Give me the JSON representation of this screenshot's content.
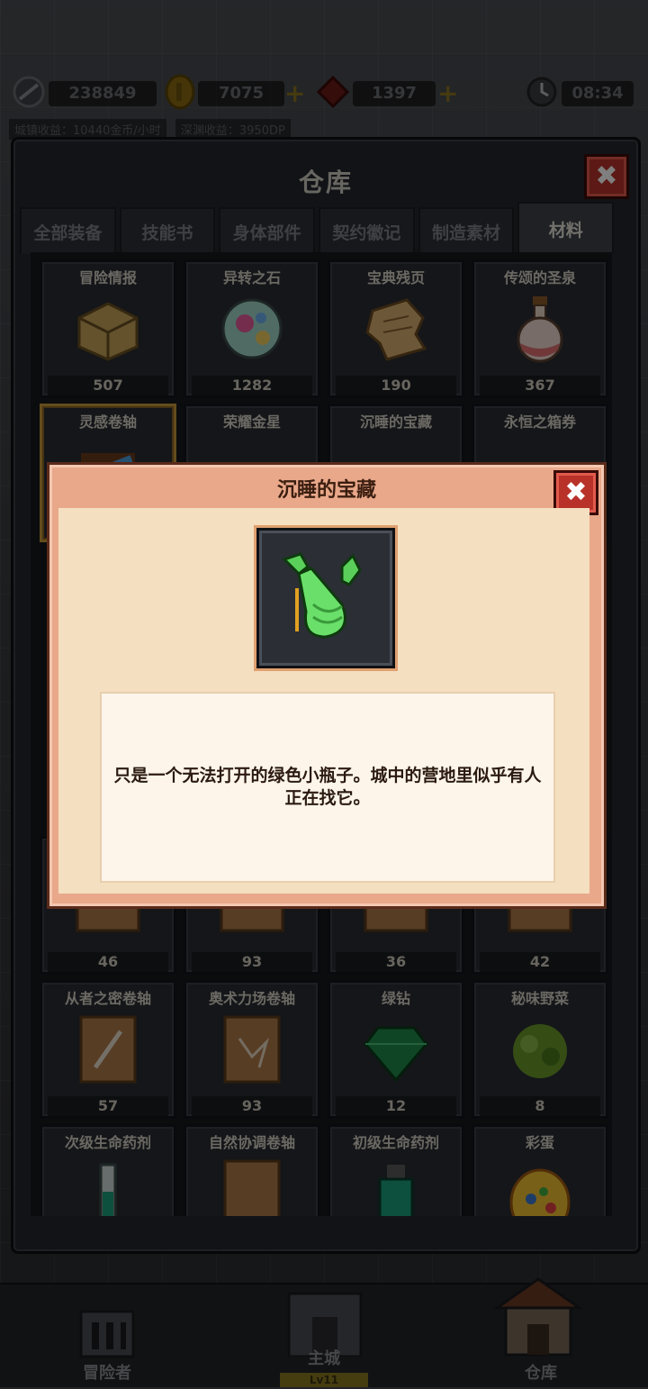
{
  "top": {
    "souls": "238849",
    "gold": "7075",
    "gems": "1397",
    "time": "08:34",
    "town_income": "城镇收益：10440金币/小时",
    "abyss_income": "深渊收益：3950DP"
  },
  "warehouse": {
    "title": "仓库",
    "close_symbol": "✖",
    "tabs": [
      {
        "label": "全部装备"
      },
      {
        "label": "技能书"
      },
      {
        "label": "身体部件"
      },
      {
        "label": "契约徽记"
      },
      {
        "label": "制造素材"
      },
      {
        "label": "材料"
      }
    ],
    "items": [
      {
        "name": "冒险情报",
        "count": "507"
      },
      {
        "name": "异转之石",
        "count": "1282"
      },
      {
        "name": "宝典残页",
        "count": "190"
      },
      {
        "name": "传颂的圣泉",
        "count": "367"
      },
      {
        "name": "灵感卷轴",
        "count": ""
      },
      {
        "name": "荣耀金星",
        "count": ""
      },
      {
        "name": "沉睡的宝藏",
        "count": ""
      },
      {
        "name": "永恒之箱券",
        "count": ""
      },
      {
        "name": "",
        "count": "46"
      },
      {
        "name": "",
        "count": "93"
      },
      {
        "name": "",
        "count": "36"
      },
      {
        "name": "",
        "count": "42"
      },
      {
        "name": "从者之密卷轴",
        "count": "57"
      },
      {
        "name": "奥术力场卷轴",
        "count": "93"
      },
      {
        "name": "绿钻",
        "count": "12"
      },
      {
        "name": "秘味野菜",
        "count": "8"
      },
      {
        "name": "次级生命药剂",
        "count": ""
      },
      {
        "name": "自然协调卷轴",
        "count": ""
      },
      {
        "name": "初级生命药剂",
        "count": ""
      },
      {
        "name": "彩蛋",
        "count": ""
      }
    ]
  },
  "dialog": {
    "title": "沉睡的宝藏",
    "close_symbol": "✖",
    "description": "只是一个无法打开的绿色小瓶子。城中的营地里似乎有人正在找它。"
  },
  "nav": {
    "adventurer": "冒险者",
    "main_city": "主城",
    "main_city_level": "Lv11",
    "warehouse": "仓库"
  },
  "colors": {
    "accent_gold": "#c89a3a",
    "close_red": "#b8322a",
    "dialog_pink": "#e9a88a"
  }
}
